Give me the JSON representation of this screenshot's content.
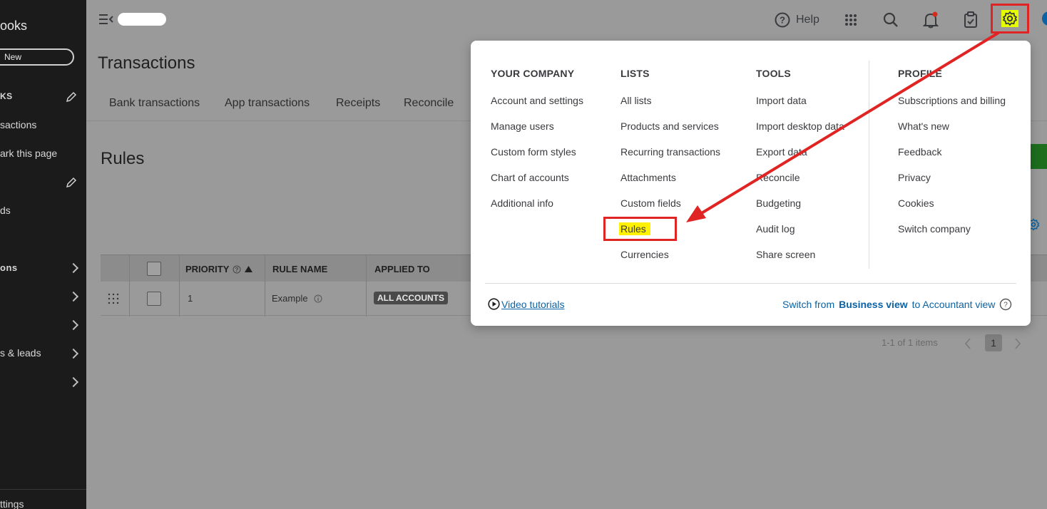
{
  "sidebar": {
    "brand": "ooks",
    "new_label": "New",
    "items": [
      {
        "label": "KS"
      },
      {
        "label": "sactions"
      },
      {
        "label": "ark this page"
      },
      {
        "label": "ds"
      },
      {
        "label": "ons"
      },
      {
        "label": "s & leads"
      }
    ],
    "bottom_label": "ttings"
  },
  "topbar": {
    "help_label": "Help",
    "icons": [
      "menu-collapse-icon",
      "question-circle-icon",
      "apps-grid-icon",
      "search-icon",
      "notification-bell-icon",
      "clipboard-icon",
      "gear-icon"
    ]
  },
  "page": {
    "title": "Transactions",
    "tabs": [
      "Bank transactions",
      "App transactions",
      "Receipts",
      "Reconcile"
    ],
    "section_title": "Rules"
  },
  "table": {
    "headers": [
      "PRIORITY",
      "RULE NAME",
      "APPLIED TO"
    ],
    "rows": [
      {
        "priority": "1",
        "rule_name": "Example",
        "applied_to": "ALL ACCOUNTS"
      }
    ],
    "pagination_text": "1-1 of 1 items",
    "current_page": "1"
  },
  "settings_menu": {
    "columns": [
      {
        "title": "YOUR COMPANY",
        "items": [
          "Account and settings",
          "Manage users",
          "Custom form styles",
          "Chart of accounts",
          "Additional info"
        ]
      },
      {
        "title": "LISTS",
        "items": [
          "All lists",
          "Products and services",
          "Recurring transactions",
          "Attachments",
          "Custom fields",
          "Rules",
          "Currencies"
        ]
      },
      {
        "title": "TOOLS",
        "items": [
          "Import data",
          "Import desktop data",
          "Export data",
          "Reconcile",
          "Budgeting",
          "Audit log",
          "Share screen"
        ]
      },
      {
        "title": "PROFILE",
        "items": [
          "Subscriptions and billing",
          "What's new",
          "Feedback",
          "Privacy",
          "Cookies",
          "Switch company"
        ]
      }
    ],
    "video_tutorials": "Video tutorials",
    "switch_prefix": "Switch from",
    "switch_business": "Business view",
    "switch_to": "to Accountant view"
  },
  "colors": {
    "annotation_red": "#e02424",
    "highlight_yellow": "#fff200",
    "link_blue": "#0b62a4",
    "brand_green": "#2ca01c"
  }
}
